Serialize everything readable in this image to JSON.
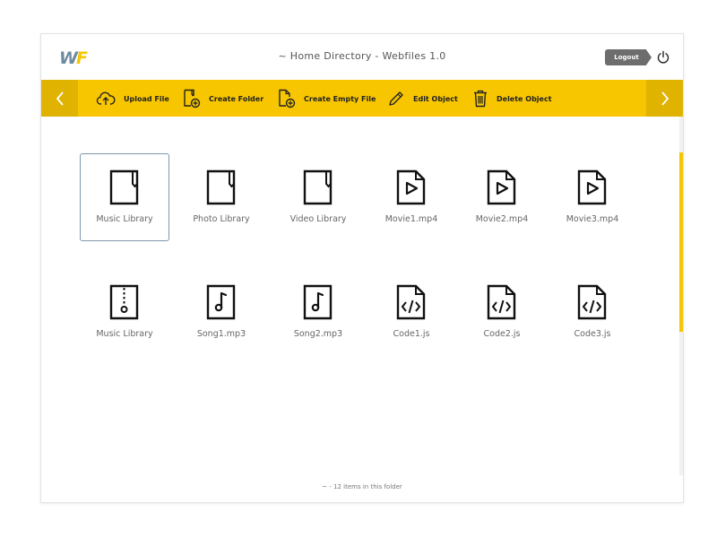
{
  "header": {
    "logo_w": "W",
    "logo_f": "F",
    "title": "~ Home Directory - Webfiles 1.0",
    "logout_label": "Logout"
  },
  "toolbar": {
    "upload_label": "Upload File",
    "create_folder_label": "Create Folder",
    "create_empty_file_label": "Create Empty File",
    "edit_label": "Edit Object",
    "delete_label": "Delete Object"
  },
  "files": [
    {
      "name": "Music Library",
      "icon": "folder-icon"
    },
    {
      "name": "Photo Library",
      "icon": "folder-icon"
    },
    {
      "name": "Video Library",
      "icon": "folder-icon"
    },
    {
      "name": "Movie1.mp4",
      "icon": "video-file-icon"
    },
    {
      "name": "Movie2.mp4",
      "icon": "video-file-icon"
    },
    {
      "name": "Movie3.mp4",
      "icon": "video-file-icon"
    },
    {
      "name": "Music Library",
      "icon": "archive-file-icon"
    },
    {
      "name": "Song1.mp3",
      "icon": "audio-file-icon"
    },
    {
      "name": "Song2.mp3",
      "icon": "audio-file-icon"
    },
    {
      "name": "Code1.js",
      "icon": "code-file-icon"
    },
    {
      "name": "Code2.js",
      "icon": "code-file-icon"
    },
    {
      "name": "Code3.js",
      "icon": "code-file-icon"
    }
  ],
  "footer": {
    "status": "~ - 12 items in this folder"
  },
  "colors": {
    "accent": "#f7c600",
    "accent_dark": "#e0b300",
    "selection_border": "#7f98ad"
  }
}
